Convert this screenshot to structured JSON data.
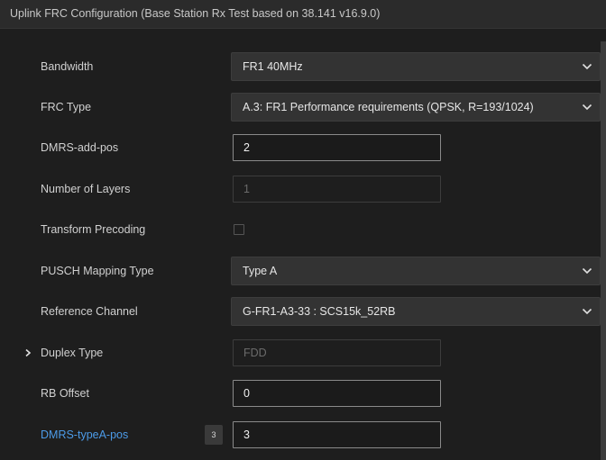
{
  "header": {
    "title": "Uplink FRC Configuration (Base Station Rx Test based on 38.141 v16.9.0)"
  },
  "rows": {
    "bandwidth": {
      "label": "Bandwidth",
      "value": "FR1 40MHz"
    },
    "frc_type": {
      "label": "FRC Type",
      "value": "A.3: FR1 Performance requirements (QPSK, R=193/1024)"
    },
    "dmrs_add_pos": {
      "label": "DMRS-add-pos",
      "value": "2"
    },
    "num_layers": {
      "label": "Number of Layers",
      "value": "1"
    },
    "transform_precoding": {
      "label": "Transform Precoding",
      "checked": false
    },
    "pusch_mapping": {
      "label": "PUSCH Mapping Type",
      "value": "Type A"
    },
    "reference_channel": {
      "label": "Reference Channel",
      "value": "G-FR1-A3-33 : SCS15k_52RB"
    },
    "duplex_type": {
      "label": "Duplex Type",
      "value": "FDD"
    },
    "rb_offset": {
      "label": "RB Offset",
      "value": "0"
    },
    "dmrs_typea_pos": {
      "label": "DMRS-typeA-pos",
      "badge": "3",
      "value": "3"
    }
  },
  "colors": {
    "background": "#1e1e1e",
    "header": "#2b2b2b",
    "link_label": "#4c9be8"
  },
  "icons": {
    "dropdown": "chevron-down-icon",
    "expander": "chevron-right-icon"
  }
}
